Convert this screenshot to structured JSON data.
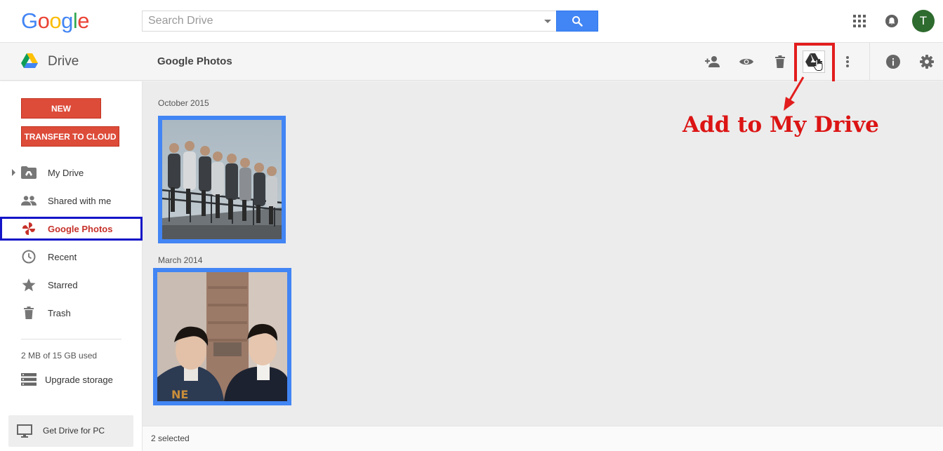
{
  "header": {
    "logo_letters": [
      "G",
      "o",
      "o",
      "g",
      "l",
      "e"
    ],
    "logo_colors": [
      "#4285f4",
      "#ea4335",
      "#fbbc05",
      "#4285f4",
      "#34a853",
      "#ea4335"
    ],
    "search_placeholder": "Search Drive",
    "avatar_letter": "T",
    "avatar_color": "#2e6b2e"
  },
  "appbar": {
    "app_name": "Drive",
    "page_title": "Google Photos",
    "tools": [
      "share-icon",
      "preview-icon",
      "trash-icon",
      "add-to-drive-icon",
      "more-icon",
      "info-icon",
      "settings-icon"
    ]
  },
  "sidebar": {
    "new_label": "NEW",
    "transfer_label": "TRANSFER TO CLOUD",
    "items": [
      {
        "label": "My Drive",
        "icon": "folder-drive-icon"
      },
      {
        "label": "Shared with me",
        "icon": "people-icon"
      },
      {
        "label": "Google Photos",
        "icon": "photos-pinwheel-icon",
        "active": true
      },
      {
        "label": "Recent",
        "icon": "clock-icon"
      },
      {
        "label": "Starred",
        "icon": "star-icon"
      },
      {
        "label": "Trash",
        "icon": "trash-icon"
      }
    ],
    "storage": "2 MB of 15 GB used",
    "upgrade_label": "Upgrade storage",
    "get_drive_label": "Get Drive for PC"
  },
  "main": {
    "groups": [
      {
        "date": "October 2015",
        "photo": "group of people walking on bridge railing"
      },
      {
        "date": "March 2014",
        "photo": "two young men in front of building"
      }
    ]
  },
  "status": {
    "selected_text": "2 selected"
  },
  "annotation": {
    "text": "Add to My Drive",
    "color": "#dc1414"
  },
  "colors": {
    "accent_blue": "#4285f4",
    "new_button": "#dd4b39",
    "active_nav": "#c6312a"
  }
}
